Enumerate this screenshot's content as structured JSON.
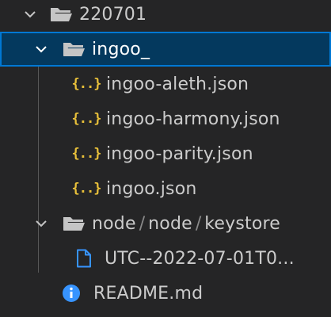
{
  "explorer": {
    "root_folder": {
      "label": "220701",
      "icon": "folder-open-icon",
      "expanded": true
    },
    "selected_folder": {
      "label": "ingoo_",
      "icon": "folder-open-icon",
      "expanded": true,
      "selected": true
    },
    "json_files": [
      {
        "label": "ingoo-aleth.json",
        "icon": "json-braces-icon"
      },
      {
        "label": "ingoo-harmony.json",
        "icon": "json-braces-icon"
      },
      {
        "label": "ingoo-parity.json",
        "icon": "json-braces-icon"
      },
      {
        "label": "ingoo.json",
        "icon": "json-braces-icon"
      }
    ],
    "json_icon_glyph": "{..}",
    "compact_folder": {
      "segments": [
        "node",
        "node",
        "keystore"
      ],
      "separator": "/",
      "icon": "folder-open-icon",
      "expanded": true
    },
    "keystore_file": {
      "label": "UTC--2022-07-01T0...",
      "icon": "file-icon"
    },
    "readme": {
      "label": "README.md",
      "icon": "info-icon"
    }
  },
  "colors": {
    "background": "#252526",
    "selection": "#04395e",
    "selection_border": "#0078d4",
    "json_icon": "#e8c03a",
    "file_icon": "#3794ff",
    "info_icon": "#3794ff",
    "folder_icon": "#c5c5c5",
    "text": "#cccccc"
  }
}
